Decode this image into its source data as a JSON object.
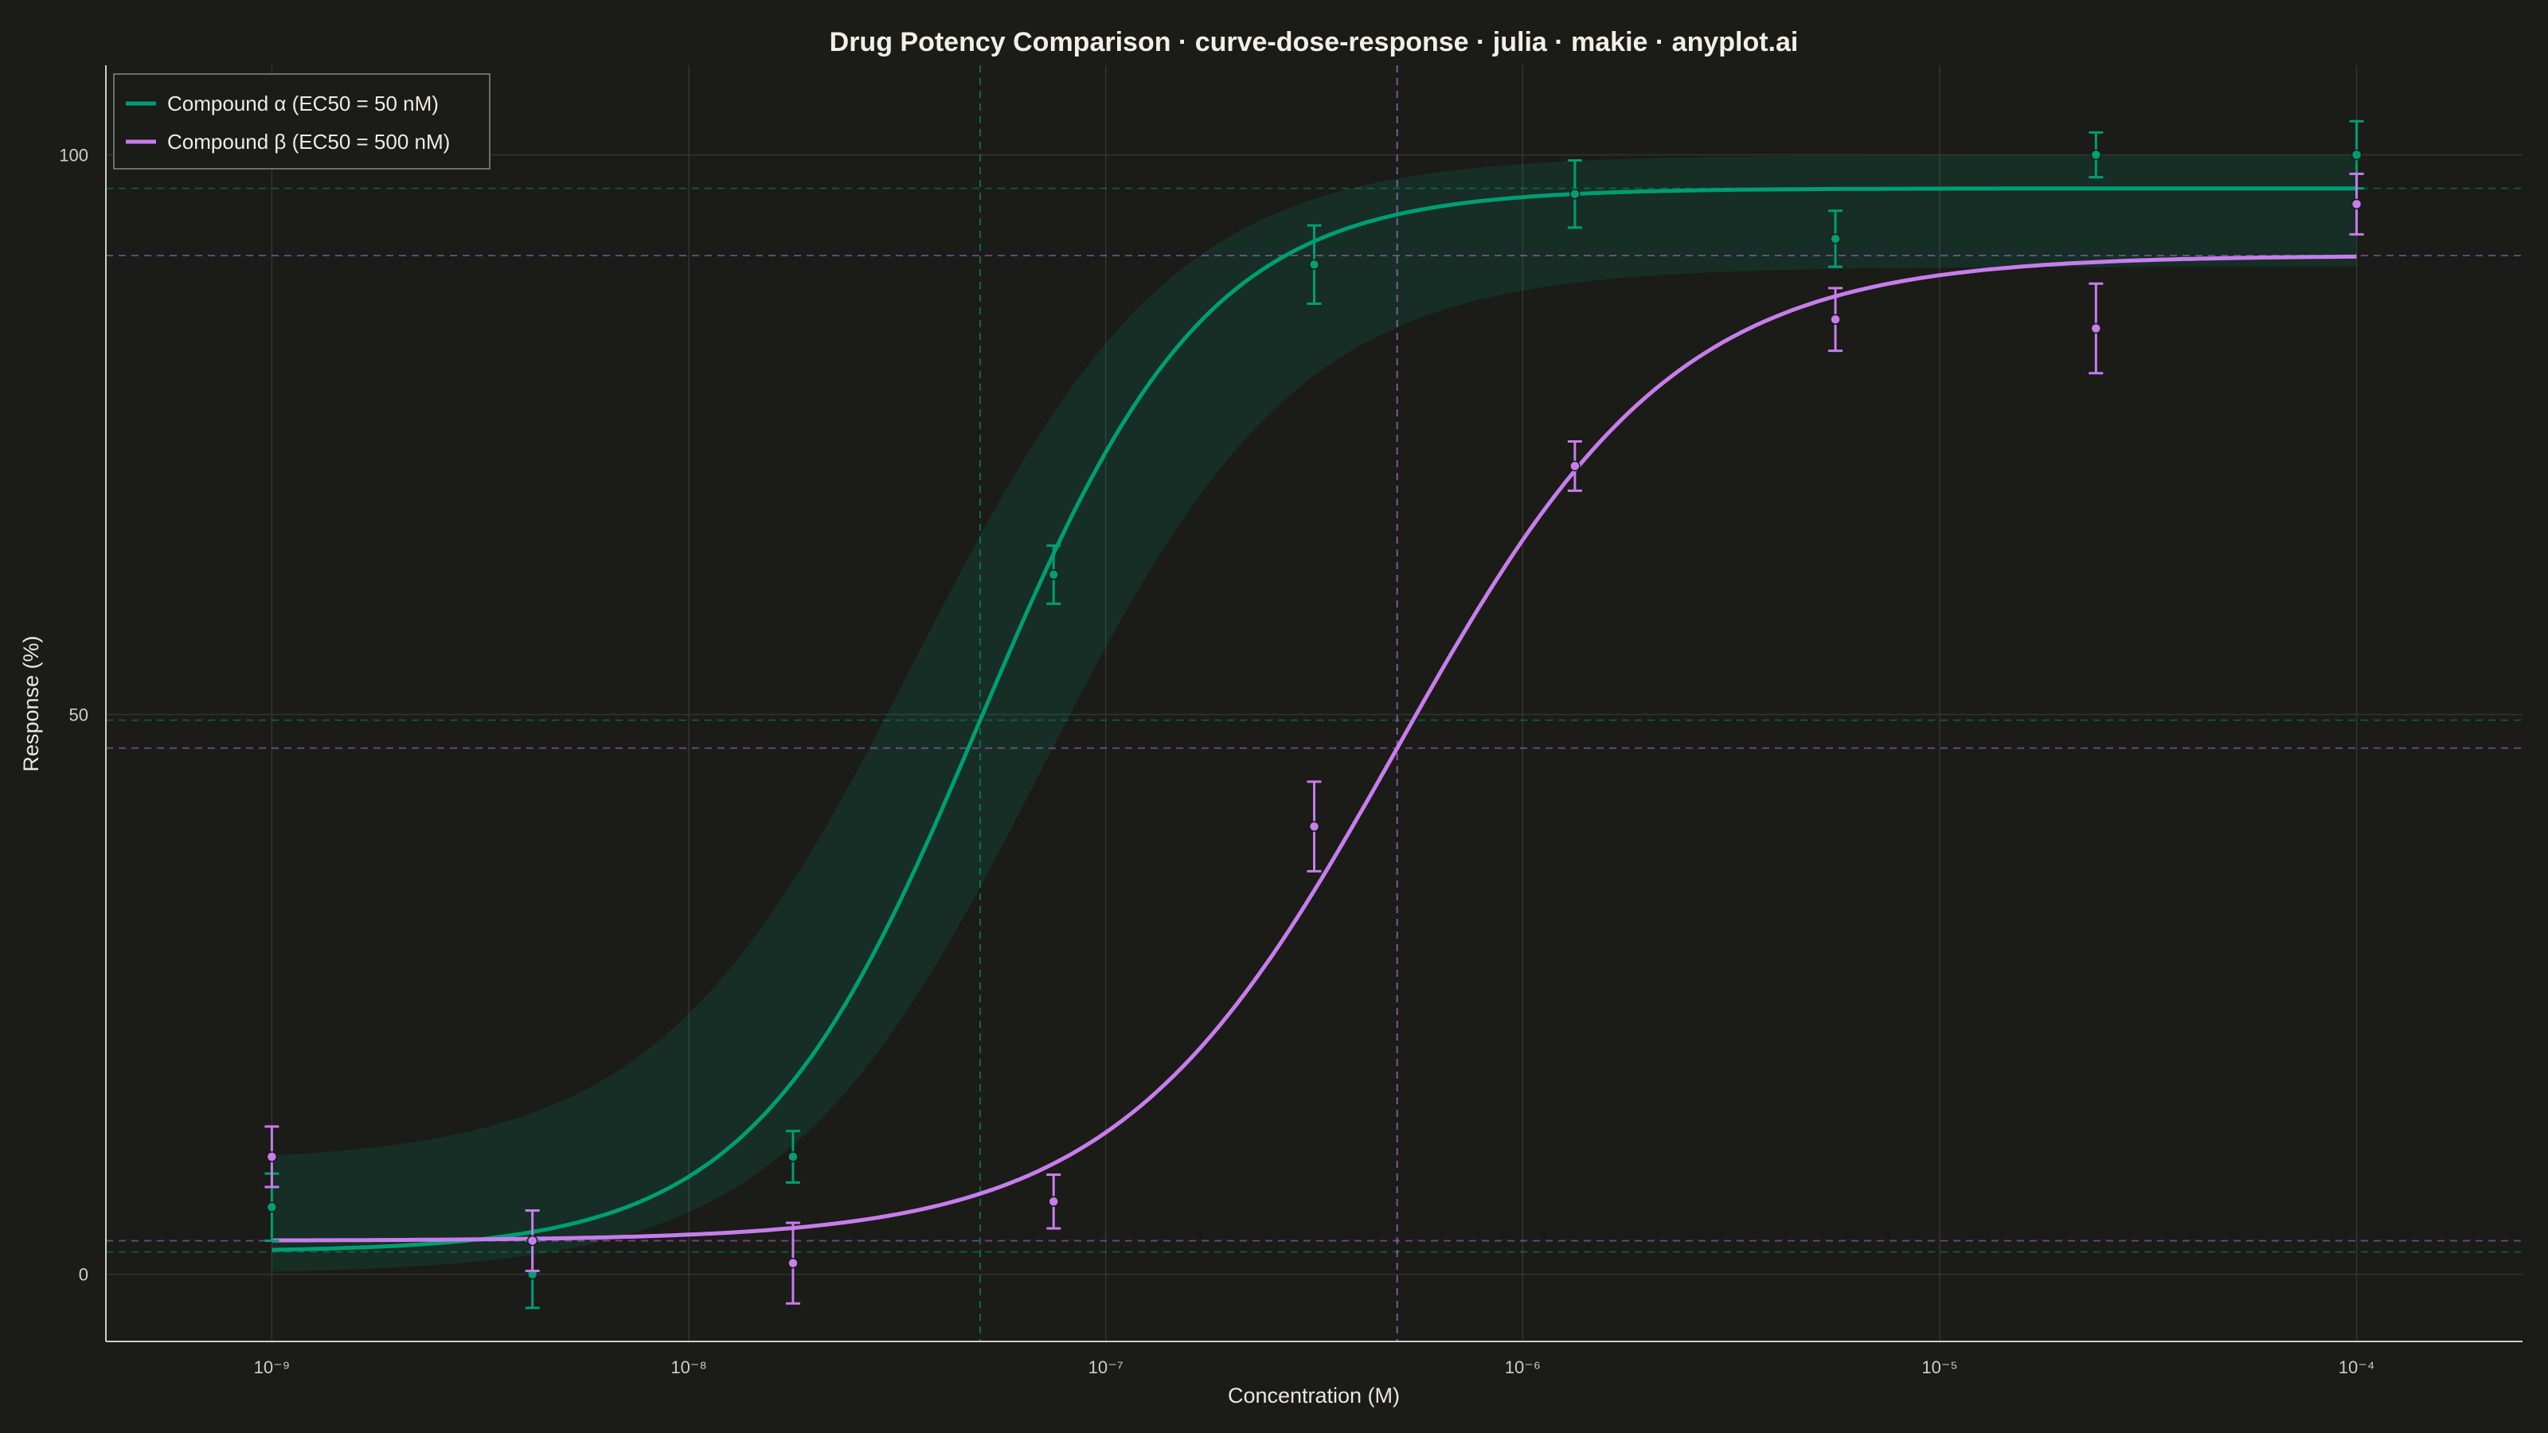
{
  "chart_data": {
    "type": "line",
    "title": "Drug Potency Comparison · curve-dose-response · julia · makie · anyplot.ai",
    "xlabel": "Concentration (M)",
    "ylabel": "Response (%)",
    "x_scale": "log10",
    "xlim": [
      4e-10,
      0.00025
    ],
    "ylim": [
      -6,
      108
    ],
    "x_ticks": [
      {
        "value": 1e-09,
        "label": "10⁻⁹"
      },
      {
        "value": 1e-08,
        "label": "10⁻⁸"
      },
      {
        "value": 1e-07,
        "label": "10⁻⁷"
      },
      {
        "value": 1e-06,
        "label": "10⁻⁶"
      },
      {
        "value": 1e-05,
        "label": "10⁻⁵"
      },
      {
        "value": 0.0001,
        "label": "10⁻⁴"
      }
    ],
    "y_ticks": [
      {
        "value": 0,
        "label": "0"
      },
      {
        "value": 50,
        "label": "50"
      },
      {
        "value": 100,
        "label": "100"
      }
    ],
    "grid": true,
    "legend_position": "top-left",
    "series": [
      {
        "name": "Compound α  (EC50 = 50 nM)",
        "color": "#009e73",
        "fit": {
          "bottom": 2,
          "top": 97,
          "ec50": 5e-08,
          "hill": 1.6
        },
        "band": {
          "lower_bottom": 0,
          "lower_top": 90,
          "lower_ec50": 7e-08,
          "upper_bottom": 10,
          "upper_top": 100,
          "upper_ec50": 3.5e-08,
          "hill": 1.4
        },
        "points": [
          {
            "x": 1e-09,
            "y": 6,
            "err": 3
          },
          {
            "x": 4.217e-09,
            "y": 0,
            "err": 3
          },
          {
            "x": 1.778e-08,
            "y": 10.5,
            "err": 2.3
          },
          {
            "x": 7.499e-08,
            "y": 62.5,
            "err": 2.6
          },
          {
            "x": 3.162e-07,
            "y": 90.2,
            "err": 3.5
          },
          {
            "x": 1.334e-06,
            "y": 96.5,
            "err": 3
          },
          {
            "x": 5.623e-06,
            "y": 92.5,
            "err": 2.5
          },
          {
            "x": 2.371e-05,
            "y": 100,
            "err": 2
          },
          {
            "x": 0.0001,
            "y": 100,
            "err": 3
          }
        ],
        "guides": {
          "top": 97,
          "half": 49.5,
          "bottom": 2,
          "ec50": 5e-08
        }
      },
      {
        "name": "Compound β  (EC50 = 500 nM)",
        "color": "#c77dec",
        "fit": {
          "bottom": 3,
          "top": 91,
          "ec50": 5e-07,
          "hill": 1.3
        },
        "points": [
          {
            "x": 1e-09,
            "y": 10.5,
            "err": 2.7
          },
          {
            "x": 4.217e-09,
            "y": 3,
            "err": 2.7
          },
          {
            "x": 1.778e-08,
            "y": 1,
            "err": 3.6
          },
          {
            "x": 7.499e-08,
            "y": 6.5,
            "err": 2.4
          },
          {
            "x": 3.162e-07,
            "y": 40,
            "err": 4
          },
          {
            "x": 1.334e-06,
            "y": 72.2,
            "err": 2.2
          },
          {
            "x": 5.623e-06,
            "y": 85.3,
            "err": 2.8
          },
          {
            "x": 2.371e-05,
            "y": 84.5,
            "err": 4
          },
          {
            "x": 0.0001,
            "y": 95.6,
            "err": 2.7
          }
        ],
        "guides": {
          "top": 91,
          "half": 47,
          "bottom": 3,
          "ec50": 5e-07
        }
      }
    ]
  }
}
